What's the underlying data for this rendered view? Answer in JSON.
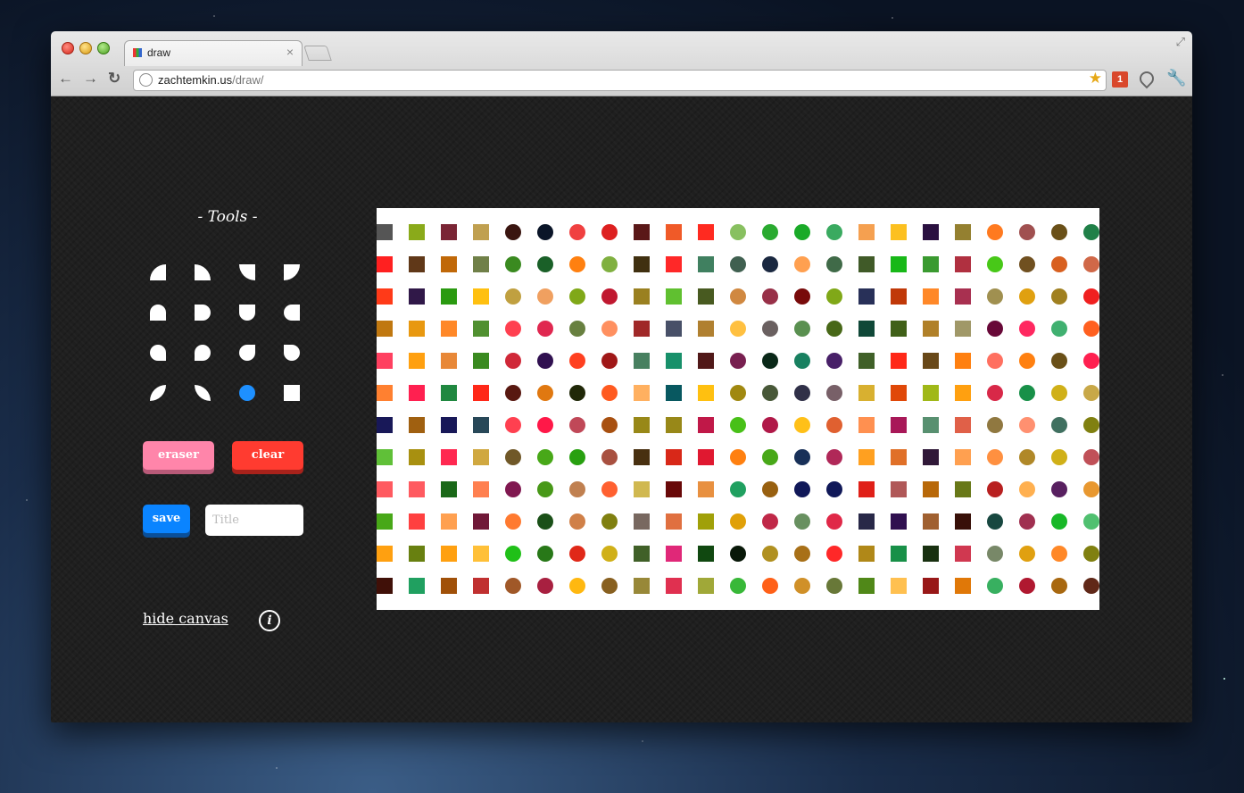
{
  "browser": {
    "tab_title": "draw",
    "tab_close": "×",
    "fullscreen_icon": "⤢",
    "nav": {
      "back": "←",
      "forward": "→",
      "reload": "↻"
    },
    "url_host": "zachtemkin.us",
    "url_path": "/draw/",
    "star_icon": "★",
    "extension_badge": "1",
    "wrench_icon": "🔧"
  },
  "tools": {
    "title": "- Tools -",
    "shapes": [
      "quarter-top-left",
      "quarter-top-right",
      "quarter-bottom-left",
      "quarter-bottom-right",
      "dome-top",
      "dome-right",
      "dome-bottom",
      "dome-left",
      "blob-a",
      "blob-b",
      "blob-c",
      "blob-d",
      "leaf-a",
      "leaf-b",
      "circle",
      "square"
    ],
    "selected_shape_color": "#1e90ff",
    "eraser_label": "eraser",
    "clear_label": "clear",
    "save_label": "save",
    "title_placeholder": "Title",
    "hide_canvas_label": "hide canvas",
    "info_icon": "i"
  },
  "canvas": {
    "columns": 23,
    "rows": 12,
    "column_shapes": [
      "square",
      "square",
      "square",
      "square",
      "circle",
      "circle",
      "circle",
      "circle",
      "square",
      "square",
      "square",
      "circle",
      "circle",
      "circle",
      "circle",
      "square",
      "square",
      "square",
      "square",
      "circle",
      "circle",
      "circle",
      "circle"
    ],
    "colors": [
      [
        "#555",
        "#8aaa1a",
        "#7a2535",
        "#c0a050",
        "#3a1510",
        "#0a1528",
        "#f04040",
        "#dd2020",
        "#5a1818",
        "#f05a28",
        "#ff2a20",
        "#88c060",
        "#2aaa30",
        "#1aaa28",
        "#3aaa60",
        "#f5a050",
        "#fcc020",
        "#2a1040",
        "#948030",
        "#ff7a20",
        "#a05050",
        "#6a5018",
        "#208048"
      ],
      [
        "#ff2020",
        "#603818",
        "#c06808",
        "#708048",
        "#3a8a20",
        "#1a6028",
        "#ff8010",
        "#80b040",
        "#403010",
        "#ff2828",
        "#408060",
        "#406050",
        "#1a2840",
        "#ffa050",
        "#406a48",
        "#405a28",
        "#18b818",
        "#3a9a30",
        "#b03040",
        "#48c818",
        "#705020",
        "#d86020",
        "#d06848"
      ],
      [
        "#ff3a18",
        "#301848",
        "#2a9a10",
        "#ffc010",
        "#c0a040",
        "#f0a060",
        "#80a818",
        "#c01830",
        "#9a8020",
        "#60c030",
        "#485a20",
        "#d08840",
        "#983048",
        "#780a0a",
        "#80a818",
        "#283058",
        "#c03808",
        "#ff8828",
        "#a83050",
        "#a09050",
        "#e0a010",
        "#a08020",
        "#f02020"
      ],
      [
        "#c07810",
        "#e89810",
        "#ff8828",
        "#509030",
        "#ff4050",
        "#e02850",
        "#688040",
        "#ff9060",
        "#a02828",
        "#485068",
        "#b08030",
        "#ffc040",
        "#6a6060",
        "#5a9050",
        "#486818",
        "#104838",
        "#406018",
        "#b08028",
        "#a09868",
        "#680838",
        "#ff2860",
        "#40b070",
        "#ff6020"
      ],
      [
        "#ff4060",
        "#ffa010",
        "#e88838",
        "#3a8a20",
        "#d02838",
        "#301050",
        "#ff4020",
        "#a01818",
        "#488060",
        "#18906a",
        "#501818",
        "#782050",
        "#0a2818",
        "#188060",
        "#482068",
        "#406028",
        "#ff2818",
        "#684818",
        "#ff8010",
        "#ff7060",
        "#ff8010",
        "#6a5018",
        "#ff2050"
      ],
      [
        "#ff8030",
        "#ff2050",
        "#208840",
        "#ff2818",
        "#581810",
        "#e07810",
        "#202808",
        "#ff5a20",
        "#ffb060",
        "#085860",
        "#ffc010",
        "#a08810",
        "#485838",
        "#303048",
        "#786068",
        "#d8b030",
        "#e04808",
        "#a0b818",
        "#ffa010",
        "#d82848",
        "#189048",
        "#d0b018",
        "#c8a848"
      ],
      [
        "#181858",
        "#a06010",
        "#181858",
        "#284858",
        "#ff4050",
        "#ff1848",
        "#c04858",
        "#a85010",
        "#988818",
        "#988818",
        "#c01848",
        "#48c018",
        "#b01848",
        "#ffc018",
        "#e06030",
        "#ff9050",
        "#a81858",
        "#589070",
        "#e06048",
        "#907840",
        "#ff9070",
        "#407060",
        "#808010"
      ],
      [
        "#60c038",
        "#a89010",
        "#ff2850",
        "#d0a840",
        "#705828",
        "#48a818",
        "#28a010",
        "#a85040",
        "#483010",
        "#d82818",
        "#e01830",
        "#ff8010",
        "#48a818",
        "#183058",
        "#b02858",
        "#ffa020",
        "#e07028",
        "#301838",
        "#ffa050",
        "#ff9040",
        "#b08828",
        "#d0b018",
        "#c05058"
      ],
      [
        "#ff5a60",
        "#ff5a60",
        "#1a6818",
        "#ff8050",
        "#801850",
        "#489818",
        "#c08050",
        "#ff6030",
        "#d0b850",
        "#680808",
        "#e89040",
        "#20a060",
        "#986010",
        "#101858",
        "#101858",
        "#e02018",
        "#b05858",
        "#b86808",
        "#687818",
        "#b82020",
        "#ffb050",
        "#582060",
        "#e89830"
      ],
      [
        "#48a818",
        "#ff4040",
        "#ffa050",
        "#701838",
        "#ff7a30",
        "#1a5018",
        "#d08048",
        "#808010",
        "#786860",
        "#e07040",
        "#a0a008",
        "#e0a008",
        "#c02848",
        "#689060",
        "#e02848",
        "#282848",
        "#301050",
        "#a06030",
        "#381008",
        "#184840",
        "#a03050",
        "#18b828",
        "#50c070"
      ],
      [
        "#ffa010",
        "#688010",
        "#ffa010",
        "#ffc038",
        "#20c018",
        "#287818",
        "#e02818",
        "#d0b018",
        "#406028",
        "#e02878",
        "#104810",
        "#081808",
        "#b09020",
        "#a87018",
        "#ff2828",
        "#b08818",
        "#189048",
        "#183010",
        "#d03850",
        "#788868",
        "#e0a010",
        "#ff8828",
        "#808010"
      ],
      [
        "#401008",
        "#20a060",
        "#a05008",
        "#c03030",
        "#a05828",
        "#a82040",
        "#ffb810",
        "#886020",
        "#988838",
        "#e03050",
        "#a0a838",
        "#38b838",
        "#ff6018",
        "#d09028",
        "#687838",
        "#508818",
        "#ffc050",
        "#981818",
        "#e07808",
        "#38b060",
        "#b01830",
        "#a86810",
        "#602818"
      ]
    ]
  }
}
